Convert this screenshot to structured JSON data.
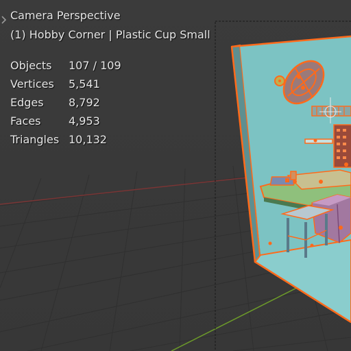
{
  "viewport": {
    "view_name": "Camera Perspective",
    "active_object": "(1) Hobby Corner | Plastic Cup Small",
    "stats": [
      {
        "label": "Objects",
        "value": "107 / 109"
      },
      {
        "label": "Vertices",
        "value": "5,541"
      },
      {
        "label": "Edges",
        "value": "8,792"
      },
      {
        "label": "Faces",
        "value": "4,953"
      },
      {
        "label": "Triangles",
        "value": "10,132"
      }
    ]
  },
  "colors": {
    "background": "#3a3a3a",
    "grid_line": "#2e2e2e",
    "x_axis": "#8a3a3a",
    "y_axis": "#6c9a2a",
    "selection_outline": "#ff6a1a",
    "wall": "#7dc0c0",
    "floor": "#8ac8c8"
  },
  "icons": [
    "chevron-right-icon",
    "light-icon",
    "camera-icon"
  ]
}
